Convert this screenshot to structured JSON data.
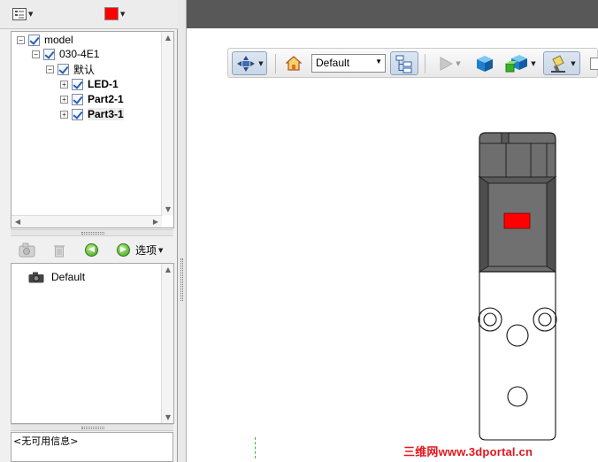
{
  "tree": {
    "nodes": [
      {
        "label": "model",
        "level": 0,
        "expander": "−",
        "bold": false
      },
      {
        "label": "030-4E1",
        "level": 1,
        "expander": "−",
        "bold": false
      },
      {
        "label": "默认",
        "level": 2,
        "expander": "−",
        "bold": false
      },
      {
        "label": "LED-1",
        "level": 3,
        "expander": "+",
        "bold": true
      },
      {
        "label": "Part2-1",
        "level": 3,
        "expander": "+",
        "bold": true
      },
      {
        "label": "Part3-1",
        "level": 3,
        "expander": "+",
        "bold": true
      }
    ]
  },
  "views_toolbar": {
    "options_label": "选项"
  },
  "views": [
    {
      "label": "Default"
    }
  ],
  "info": {
    "text": "<无可用信息>"
  },
  "viewer_toolbar": {
    "view_select_value": "Default"
  },
  "colors": {
    "part_color": "#ff0000",
    "accent_blue": "#2a5fb0",
    "watermark": "#e4161b"
  },
  "watermark": {
    "text": "三维网www.3dportal.cn"
  }
}
